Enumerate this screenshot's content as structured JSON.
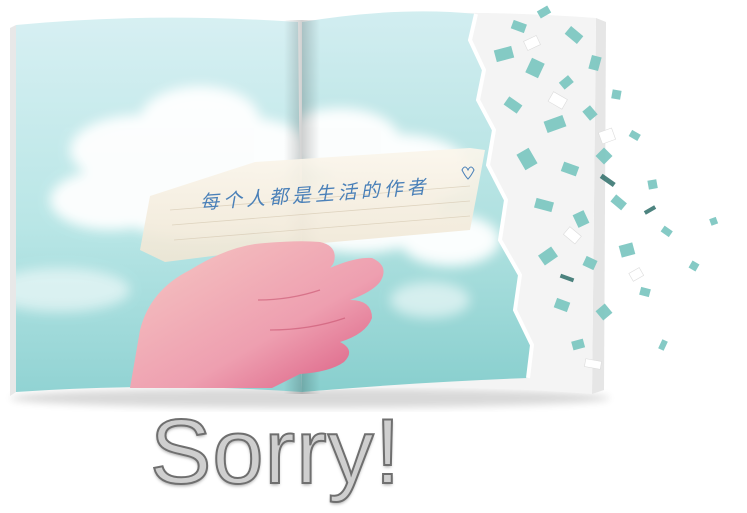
{
  "note": {
    "text": "每个人都是生活的作者"
  },
  "headline": {
    "text": "Sorry!"
  },
  "colors": {
    "sky_top": "#d9f2f4",
    "sky_bottom": "#8fd2d3",
    "cloud": "#ffffff",
    "note_ink": "#4a80b8",
    "headline_fill": "#cfcfcf",
    "headline_stroke": "#6f6f6f",
    "confetti": "#7fc8c2"
  }
}
